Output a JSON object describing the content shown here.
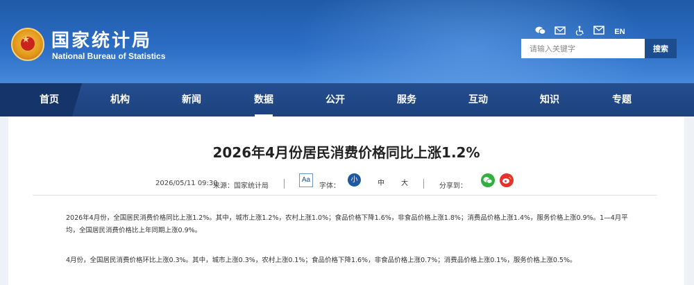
{
  "header": {
    "logo_cn": "国家统计局",
    "logo_en": "National Bureau of Statistics",
    "tool_icons": [
      "wechat-icon",
      "email-icon",
      "accessibility-icon",
      "mail-icon"
    ],
    "language": "EN",
    "search_placeholder": "请输入关键字",
    "search_button": "搜索"
  },
  "nav": {
    "items": [
      "首页",
      "机构",
      "新闻",
      "数据",
      "公开",
      "服务",
      "互动",
      "知识",
      "专题"
    ],
    "active": "数据"
  },
  "article": {
    "title": "2026年4月份居民消费价格同比上涨1.2%",
    "date": "2026/05/11 09:30",
    "source": "来源：国家统计局",
    "font_label": "字体：",
    "aa_label": "Aa",
    "size_small": "小",
    "size_medium": "中",
    "size_large": "大",
    "share_label": "分享到：",
    "paragraph1": "2026年4月份，全国居民消费价格同比上涨1.2%。其中，城市上涨1.2%，农村上涨1.0%；食品价格下降1.6%，非食品价格上涨1.8%；消费品价格上涨1.4%，服务价格上涨0.9%。1—4月平均，全国居民消费价格比上年同期上涨0.9%。",
    "paragraph2": "4月份，全国居民消费价格环比上涨0.3%。其中，城市上涨0.3%，农村上涨0.1%；食品价格下降1.6%，非食品价格上涨0.7%；消费品价格上涨0.1%，服务价格上涨0.5%。"
  },
  "colors": {
    "header": "#2b6cc4",
    "nav": "#1d427d",
    "nav_home": "#15346a",
    "search_button": "#1b4d8f",
    "wechat": "#2fb140",
    "weibo": "#e5322d"
  }
}
